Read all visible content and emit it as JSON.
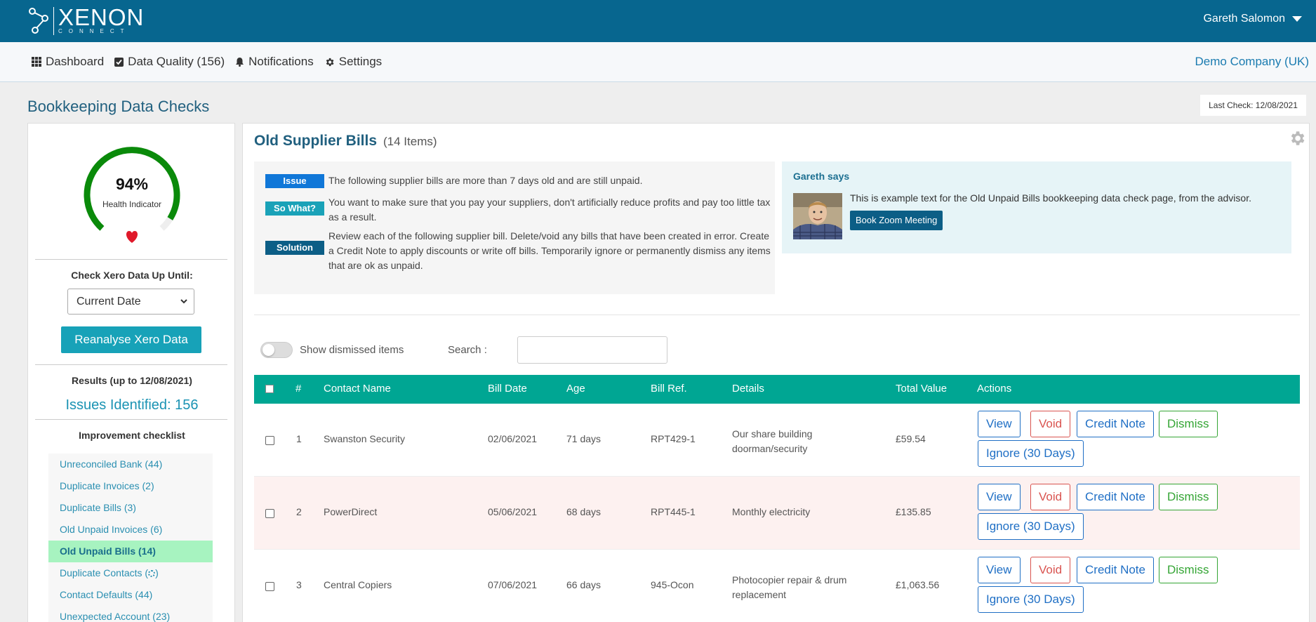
{
  "app": {
    "logo_name": "XENON",
    "logo_sub": "CONNECT",
    "user_name": "Gareth Salomon",
    "company": "Demo Company (UK)"
  },
  "nav": {
    "items": [
      {
        "label": "Dashboard",
        "icon": "grid-icon"
      },
      {
        "label": "Data Quality (156)",
        "icon": "checkbox-icon"
      },
      {
        "label": "Notifications",
        "icon": "bell-icon"
      },
      {
        "label": "Settings",
        "icon": "gear-icon"
      }
    ]
  },
  "page": {
    "title": "Bookkeeping Data Checks",
    "last_check": "Last Check: 12/08/2021"
  },
  "left": {
    "health_pct": "94%",
    "health_value": 0.94,
    "health_label": "Health Indicator",
    "check_label": "Check Xero Data Up Until:",
    "date_option": "Current Date",
    "reanalyse_label": "Reanalyse Xero Data",
    "results_label": "Results (up to 12/08/2021)",
    "issues_label": "Issues Identified: 156",
    "checklist_title": "Improvement checklist",
    "checklist": [
      {
        "label": "Unreconciled Bank (44)",
        "active": false
      },
      {
        "label": "Duplicate Invoices (2)",
        "active": false
      },
      {
        "label": "Duplicate Bills (3)",
        "active": false
      },
      {
        "label": "Old Unpaid Invoices (6)",
        "active": false
      },
      {
        "label": "Old Unpaid Bills (14)",
        "active": true
      },
      {
        "label": "Duplicate Contacts (",
        "suffix": ")",
        "spinner": true,
        "active": false
      },
      {
        "label": "Contact Defaults (44)",
        "active": false
      },
      {
        "label": "Unexpected Account (23)",
        "active": false
      }
    ]
  },
  "main": {
    "title": "Old Supplier Bills",
    "count": "(14 Items)",
    "info": [
      {
        "tag": "Issue",
        "text": "The following supplier bills are more than 7 days old and are still unpaid."
      },
      {
        "tag": "So What?",
        "text": "You want to make sure that you pay your suppliers, don't artificially reduce profits and pay too little tax as a result."
      },
      {
        "tag": "Solution",
        "text": "Review each of the following supplier bill. Delete/void any bills that have been created in error. Create a Credit Note to apply discounts or write off bills. Temporarily ignore or permanently dismiss any items that are ok as unpaid."
      }
    ],
    "advisor": {
      "title": "Gareth says",
      "text": "This is example text for the Old Unpaid Bills bookkeeping data check page, from the advisor.",
      "button": "Book Zoom Meeting"
    },
    "toggle_label": "Show dismissed items",
    "search_label": "Search :",
    "search_value": ""
  },
  "table": {
    "headers": [
      "#",
      "Contact Name",
      "Bill Date",
      "Age",
      "Bill Ref.",
      "Details",
      "Total Value",
      "Actions"
    ],
    "actions": [
      "View",
      "Void",
      "Credit Note",
      "Dismiss",
      "Ignore (30 Days)"
    ],
    "rows": [
      {
        "num": "1",
        "contact": "Swanston Security",
        "date": "02/06/2021",
        "age": "71 days",
        "ref": "RPT429-1",
        "details": "Our share building doorman/security",
        "total": "£59.54"
      },
      {
        "num": "2",
        "contact": "PowerDirect",
        "date": "05/06/2021",
        "age": "68 days",
        "ref": "RPT445-1",
        "details": "Monthly electricity",
        "total": "£135.85"
      },
      {
        "num": "3",
        "contact": "Central Copiers",
        "date": "07/06/2021",
        "age": "66 days",
        "ref": "945-Ocon",
        "details": "Photocopier repair & drum replacement",
        "total": "£1,063.56"
      }
    ]
  }
}
